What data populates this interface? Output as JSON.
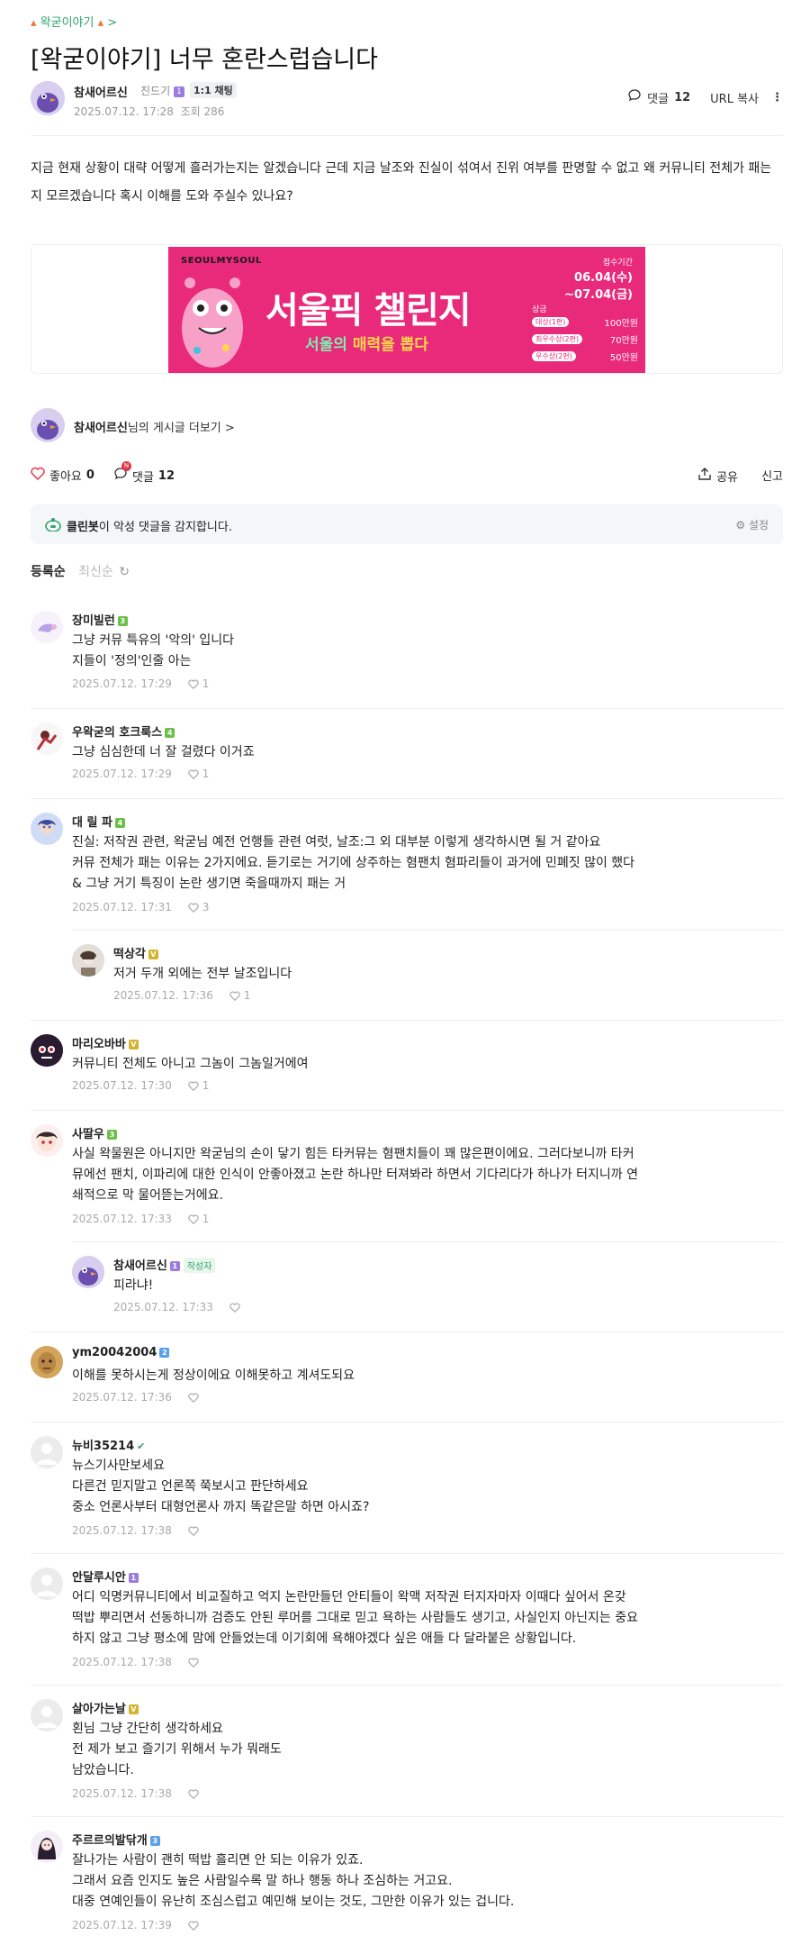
{
  "board": {
    "crumb": "왁굳이야기",
    "crumb_chevron": ">"
  },
  "post": {
    "title": "[왁굳이야기] 너무 혼란스럽습니다",
    "author": "참새어르신",
    "grade": "진드기",
    "chat_chip": "1:1 채팅",
    "date": "2025.07.12. 17:28",
    "views_label": "조회 286",
    "comment_label": "댓글",
    "comment_count": "12",
    "url_copy": "URL 복사",
    "body": "지금 현재 상황이 대략 어떻게 흘러가는지는 알겠습니다 근데 지금 날조와 진실이 섞여서 진위 여부를 판명할 수 없고 왜 커뮤니티 전체가 패는지 모르겠습니다 혹시 이해를 도와 주실수 있나요?"
  },
  "banner": {
    "brand": "SEOULMYSOUL",
    "headline": "서울픽 챌린지",
    "sub_a": "서울의 ",
    "sub_b": "매력",
    "sub_c": "을 뽑다",
    "period_label": "접수기간",
    "period_start": "06.04(수)",
    "period_end": "~07.04(금)",
    "prize_label": "상금",
    "prizes": [
      {
        "tier": "대상(1편)",
        "amount": "100만원"
      },
      {
        "tier": "최우수상(2편)",
        "amount": "70만원"
      },
      {
        "tier": "우수상(2편)",
        "amount": "50만원"
      }
    ]
  },
  "more_posts": {
    "name": "참새어르신",
    "suffix": "님의 게시글 더보기 >"
  },
  "actions": {
    "like_label": "좋아요",
    "like_count": "0",
    "comment_label": "댓글",
    "comment_count": "12",
    "new_badge": "N",
    "share": "공유",
    "report": "신고"
  },
  "cleanbot": {
    "name": "클린봇",
    "text": "이 악성 댓글을 감지합니다.",
    "settings": "설정"
  },
  "sort": {
    "registered": "등록순",
    "latest": "최신순"
  },
  "comments": [
    {
      "name": "장미빌런",
      "lvl": "3",
      "lvl_color": "#6cc04a",
      "lines": [
        "그냥 커뮤 특유의 '악의' 입니다",
        "지들이 '정의'인줄 아는"
      ],
      "date": "2025.07.12. 17:29",
      "likes": "1"
    },
    {
      "name": "우왁굳의 호크룩스",
      "lvl": "4",
      "lvl_color": "#6cc04a",
      "lines": [
        "그냥 심심한데 너 잘 걸렸다 이거죠"
      ],
      "date": "2025.07.12. 17:29",
      "likes": "1"
    },
    {
      "name": "대 릴 파",
      "lvl": "4",
      "lvl_color": "#6cc04a",
      "lines": [
        "진실: 저작권 관련, 왁굳님 예전 언행들 관련 여럿, 날조:그 외 대부분 이렇게 생각하시면 될 거 같아요",
        "커뮤 전체가 패는 이유는 2가지에요. 듣기로는 거기에 상주하는 혐팬치 혐파리들이 과거에 민폐짓 많이 했다",
        "& 그냥 거기 특징이 논란 생기면 죽을때까지 패는 거"
      ],
      "date": "2025.07.12. 17:31",
      "likes": "3"
    },
    {
      "name": "떡상각",
      "lvl": "V",
      "lvl_color": "#d4b32f",
      "lines": [
        "저거 두개 외에는 전부 날조입니다"
      ],
      "date": "2025.07.12. 17:36",
      "likes": "1"
    },
    {
      "name": "마리오바바",
      "lvl": "V",
      "lvl_color": "#d4b32f",
      "lines": [
        "커뮤니티 전체도 아니고 그놈이 그놈일거에여"
      ],
      "date": "2025.07.12. 17:30",
      "likes": "1"
    },
    {
      "name": "사딸우",
      "lvl": "3",
      "lvl_color": "#6cc04a",
      "lines": [
        "사실 왁물원은 아니지만 왁굳님의 손이 닿기 힘든 타커뮤는 혐팬치들이 꽤 많은편이에요. 그러다보니까 타커",
        "뮤에선 팬치, 이파리에 대한 인식이 안좋아졌고 논란 하나만 터져봐라 하면서 기다리다가 하나가 터지니까 연",
        "쇄적으로 막 물어뜯는거에요."
      ],
      "date": "2025.07.12. 17:33",
      "likes": "1"
    },
    {
      "name": "참새어르신",
      "lvl": "1",
      "lvl_color": "#9b7be0",
      "writer": "작성자",
      "lines": [
        "피라냐!"
      ],
      "date": "2025.07.12. 17:33",
      "likes": ""
    },
    {
      "name": "ym20042004",
      "lvl": "2",
      "lvl_color": "#5aa0e8",
      "lines": [
        "이해를 못하시는게 정상이에요 이해못하고 계셔도되요"
      ],
      "date": "2025.07.12. 17:36",
      "likes": ""
    },
    {
      "name": "뉴비35214",
      "lvl": "Y",
      "lvl_color": "#2fa36b",
      "lines": [
        "뉴스기사만보세요",
        "다른건 믿지말고 언론쪽 쭉보시고 판단하세요",
        "중소 언론사부터 대형언론사 까지 똑같은말 하면 아시죠?"
      ],
      "date": "2025.07.12. 17:38",
      "likes": ""
    },
    {
      "name": "안달루시안",
      "lvl": "1",
      "lvl_color": "#9b7be0",
      "lines": [
        "어디 익명커뮤니티에서 비교질하고 억지 논란만들던 안티들이 왁맥 저작권 터지자마자 이때다 싶어서 온갖",
        "떡밥 뿌리면서 선동하니까 검증도 안된 루머를 그대로 믿고 욕하는 사람들도 생기고, 사실인지 아닌지는 중요",
        "하지 않고 그냥 평소에 맘에 안들었는데 이기회에 욕해야겠다 싶은 애들 다 달라붙은 상황입니다."
      ],
      "date": "2025.07.12. 17:38",
      "likes": ""
    },
    {
      "name": "살아가는날",
      "lvl": "V",
      "lvl_color": "#d4b32f",
      "lines": [
        "횐님 그냥 간단히 생각하세요",
        "전 제가 보고 즐기기 위해서 누가 뭐래도",
        "남았습니다."
      ],
      "date": "2025.07.12. 17:38",
      "likes": ""
    },
    {
      "name": "주르르의발닦개",
      "lvl": "3",
      "lvl_color": "#5aa0e8",
      "lines": [
        "잘나가는 사람이 괜히 떡밥 흘리면 안 되는 이유가 있죠.",
        "그래서 요즘 인지도 높은 사람일수록 말 하나 행동 하나 조심하는 거고요.",
        "대중 연예인들이 유난히 조심스럽고 예민해 보이는 것도, 그만한 이유가 있는 겁니다."
      ],
      "date": "2025.07.12. 17:39",
      "likes": ""
    }
  ]
}
